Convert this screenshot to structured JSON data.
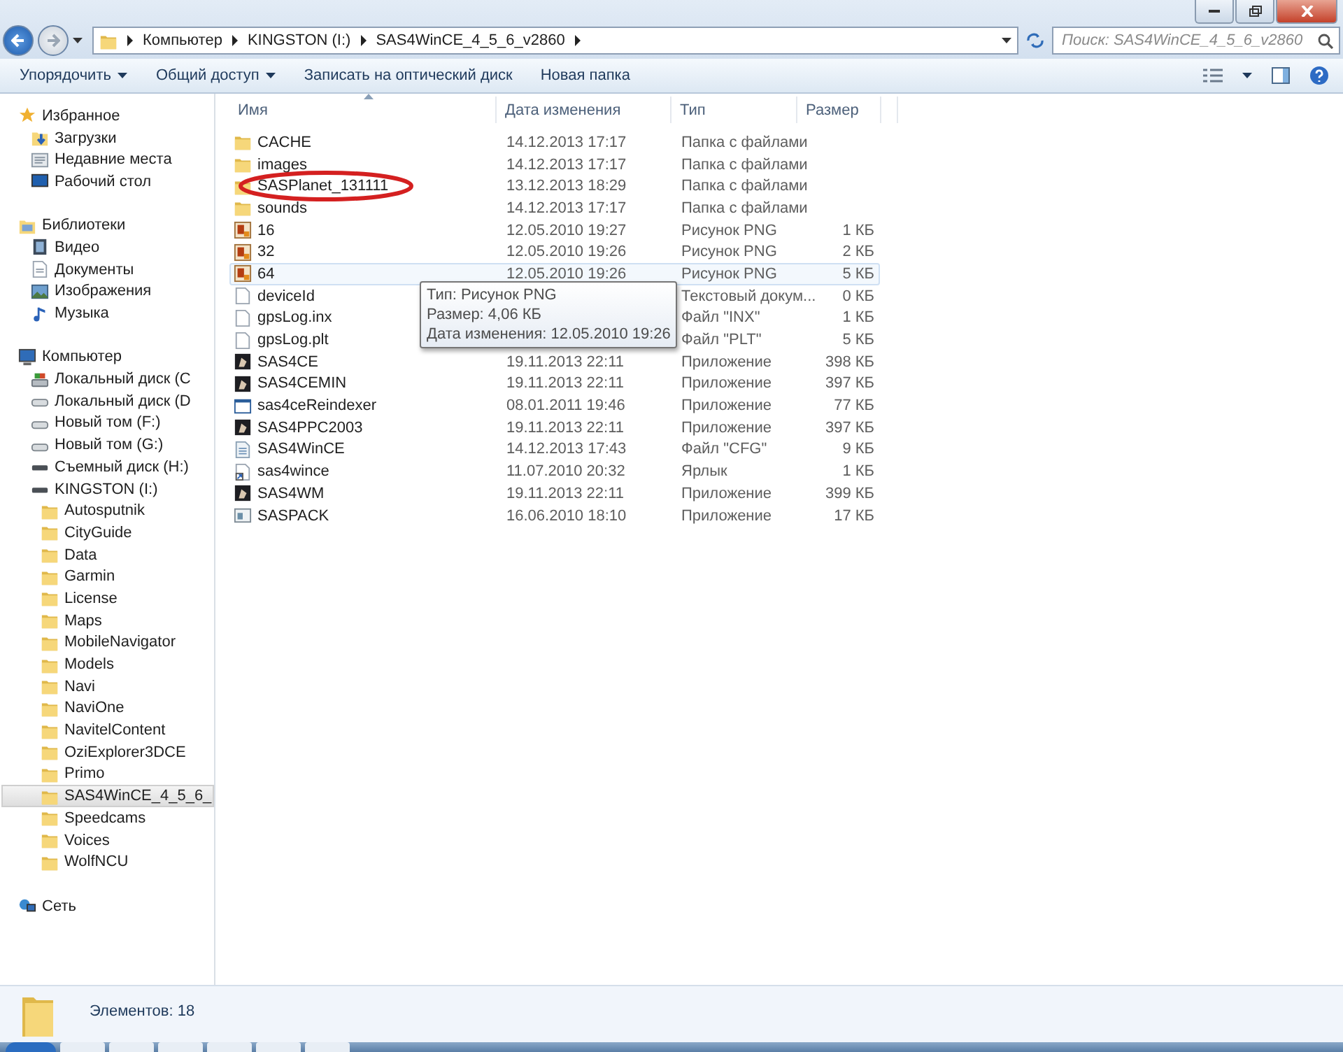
{
  "address": {
    "breadcrumbs": [
      "Компьютер",
      "KINGSTON (I:)",
      "SAS4WinCE_4_5_6_v2860"
    ]
  },
  "search": {
    "placeholder": "Поиск: SAS4WinCE_4_5_6_v2860"
  },
  "toolbar": [
    {
      "label": "Упорядочить",
      "dropdown": true
    },
    {
      "label": "Общий доступ",
      "dropdown": true
    },
    {
      "label": "Записать на оптический диск",
      "dropdown": false
    },
    {
      "label": "Новая папка",
      "dropdown": false
    }
  ],
  "sidebar": {
    "items": [
      {
        "label": "Избранное",
        "kind": "favorites",
        "selected": false,
        "children": [
          {
            "label": "Загрузки",
            "kind": "downloads",
            "selected": false
          },
          {
            "label": "Недавние места",
            "kind": "recent",
            "selected": false
          },
          {
            "label": "Рабочий стол",
            "kind": "desktop",
            "selected": false
          }
        ]
      },
      {
        "label": "Библиотеки",
        "kind": "libraries",
        "selected": false,
        "children": [
          {
            "label": "Видео",
            "kind": "video",
            "selected": false
          },
          {
            "label": "Документы",
            "kind": "documents",
            "selected": false
          },
          {
            "label": "Изображения",
            "kind": "images",
            "selected": false
          },
          {
            "label": "Музыка",
            "kind": "music",
            "selected": false
          }
        ]
      },
      {
        "label": "Компьютер",
        "kind": "computer",
        "selected": false,
        "children": [
          {
            "label": "Локальный диск (C",
            "kind": "system-drive",
            "selected": false
          },
          {
            "label": "Локальный диск (D",
            "kind": "drive",
            "selected": false
          },
          {
            "label": "Новый том (F:)",
            "kind": "drive",
            "selected": false
          },
          {
            "label": "Новый том (G:)",
            "kind": "drive",
            "selected": false
          },
          {
            "label": "Съемный диск (H:)",
            "kind": "removable",
            "selected": false
          },
          {
            "label": "KINGSTON (I:)",
            "kind": "removable",
            "selected": false,
            "children": [
              {
                "label": "Autosputnik",
                "kind": "folder",
                "selected": false
              },
              {
                "label": "CityGuide",
                "kind": "folder",
                "selected": false
              },
              {
                "label": "Data",
                "kind": "folder",
                "selected": false
              },
              {
                "label": "Garmin",
                "kind": "folder",
                "selected": false
              },
              {
                "label": "License",
                "kind": "folder",
                "selected": false
              },
              {
                "label": "Maps",
                "kind": "folder",
                "selected": false
              },
              {
                "label": "MobileNavigator",
                "kind": "folder",
                "selected": false
              },
              {
                "label": "Models",
                "kind": "folder",
                "selected": false
              },
              {
                "label": "Navi",
                "kind": "folder",
                "selected": false
              },
              {
                "label": "NaviOne",
                "kind": "folder",
                "selected": false
              },
              {
                "label": "NavitelContent",
                "kind": "folder",
                "selected": false
              },
              {
                "label": "OziExplorer3DCE",
                "kind": "folder",
                "selected": false
              },
              {
                "label": "Primo",
                "kind": "folder",
                "selected": false
              },
              {
                "label": "SAS4WinCE_4_5_6_",
                "kind": "folder",
                "selected": true
              },
              {
                "label": "Speedcams",
                "kind": "folder",
                "selected": false
              },
              {
                "label": "Voices",
                "kind": "folder",
                "selected": false
              },
              {
                "label": "WolfNCU",
                "kind": "folder",
                "selected": false
              }
            ]
          }
        ]
      },
      {
        "label": "Сеть",
        "kind": "network",
        "selected": false
      }
    ]
  },
  "columns": [
    {
      "label": "Имя",
      "sorted": true
    },
    {
      "label": "Дата изменения",
      "sorted": false
    },
    {
      "label": "Тип",
      "sorted": false
    },
    {
      "label": "Размер",
      "sorted": false
    }
  ],
  "rows": [
    {
      "name": "CACHE",
      "kind": "folder",
      "date": "14.12.2013 17:17",
      "type": "Папка с файлами",
      "hovered": false,
      "circled": false
    },
    {
      "name": "images",
      "kind": "folder",
      "date": "14.12.2013 17:17",
      "type": "Папка с файлами",
      "hovered": false,
      "circled": false
    },
    {
      "name": "SASPlanet_131111",
      "kind": "folder",
      "date": "13.12.2013 18:29",
      "type": "Папка с файлами",
      "hovered": false,
      "circled": true
    },
    {
      "name": "sounds",
      "kind": "folder",
      "date": "14.12.2013 17:17",
      "type": "Папка с файлами",
      "hovered": false,
      "circled": false
    },
    {
      "name": "16",
      "kind": "image",
      "date": "12.05.2010 19:27",
      "type": "Рисунок PNG",
      "size": "1 КБ",
      "hovered": false,
      "circled": false
    },
    {
      "name": "32",
      "kind": "image",
      "date": "12.05.2010 19:26",
      "type": "Рисунок PNG",
      "size": "2 КБ",
      "hovered": false,
      "circled": false
    },
    {
      "name": "64",
      "kind": "image",
      "date": "12.05.2010 19:26",
      "type": "Рисунок PNG",
      "size": "5 КБ",
      "hovered": true,
      "circled": false
    },
    {
      "name": "deviceId",
      "kind": "document",
      "type": "Текстовый докум...",
      "size": "0 КБ",
      "hovered": false,
      "circled": false
    },
    {
      "name": "gpsLog.inx",
      "kind": "document",
      "type": "Файл \"INX\"",
      "size": "1 КБ",
      "hovered": false,
      "circled": false
    },
    {
      "name": "gpsLog.plt",
      "kind": "document",
      "type": "Файл \"PLT\"",
      "size": "5 КБ",
      "hovered": false,
      "circled": false
    },
    {
      "name": "SAS4CE",
      "kind": "app",
      "date": "19.11.2013 22:11",
      "type": "Приложение",
      "size": "398 КБ",
      "hovered": false,
      "circled": false
    },
    {
      "name": "SAS4CEMIN",
      "kind": "app",
      "date": "19.11.2013 22:11",
      "type": "Приложение",
      "size": "397 КБ",
      "hovered": false,
      "circled": false
    },
    {
      "name": "sas4ceReindexer",
      "kind": "window",
      "date": "08.01.2011 19:46",
      "type": "Приложение",
      "size": "77 КБ",
      "hovered": false,
      "circled": false
    },
    {
      "name": "SAS4PPC2003",
      "kind": "app",
      "date": "19.11.2013 22:11",
      "type": "Приложение",
      "size": "397 КБ",
      "hovered": false,
      "circled": false
    },
    {
      "name": "SAS4WinCE",
      "kind": "config",
      "date": "14.12.2013 17:43",
      "type": "Файл \"CFG\"",
      "size": "9 КБ",
      "hovered": false,
      "circled": false
    },
    {
      "name": "sas4wince",
      "kind": "shortcut",
      "date": "11.07.2010 20:32",
      "type": "Ярлык",
      "size": "1 КБ",
      "hovered": false,
      "circled": false
    },
    {
      "name": "SAS4WM",
      "kind": "app",
      "date": "19.11.2013 22:11",
      "type": "Приложение",
      "size": "399 КБ",
      "hovered": false,
      "circled": false
    },
    {
      "name": "SASPACK",
      "kind": "pack",
      "date": "16.06.2010 18:10",
      "type": "Приложение",
      "size": "17 КБ",
      "hovered": false,
      "circled": false
    }
  ],
  "tooltip": {
    "lines": [
      "Тип: Рисунок PNG",
      "Размер: 4,06 КБ",
      "Дата изменения: 12.05.2010 19:26"
    ]
  },
  "status_bar": {
    "text": "Элементов: 18"
  }
}
